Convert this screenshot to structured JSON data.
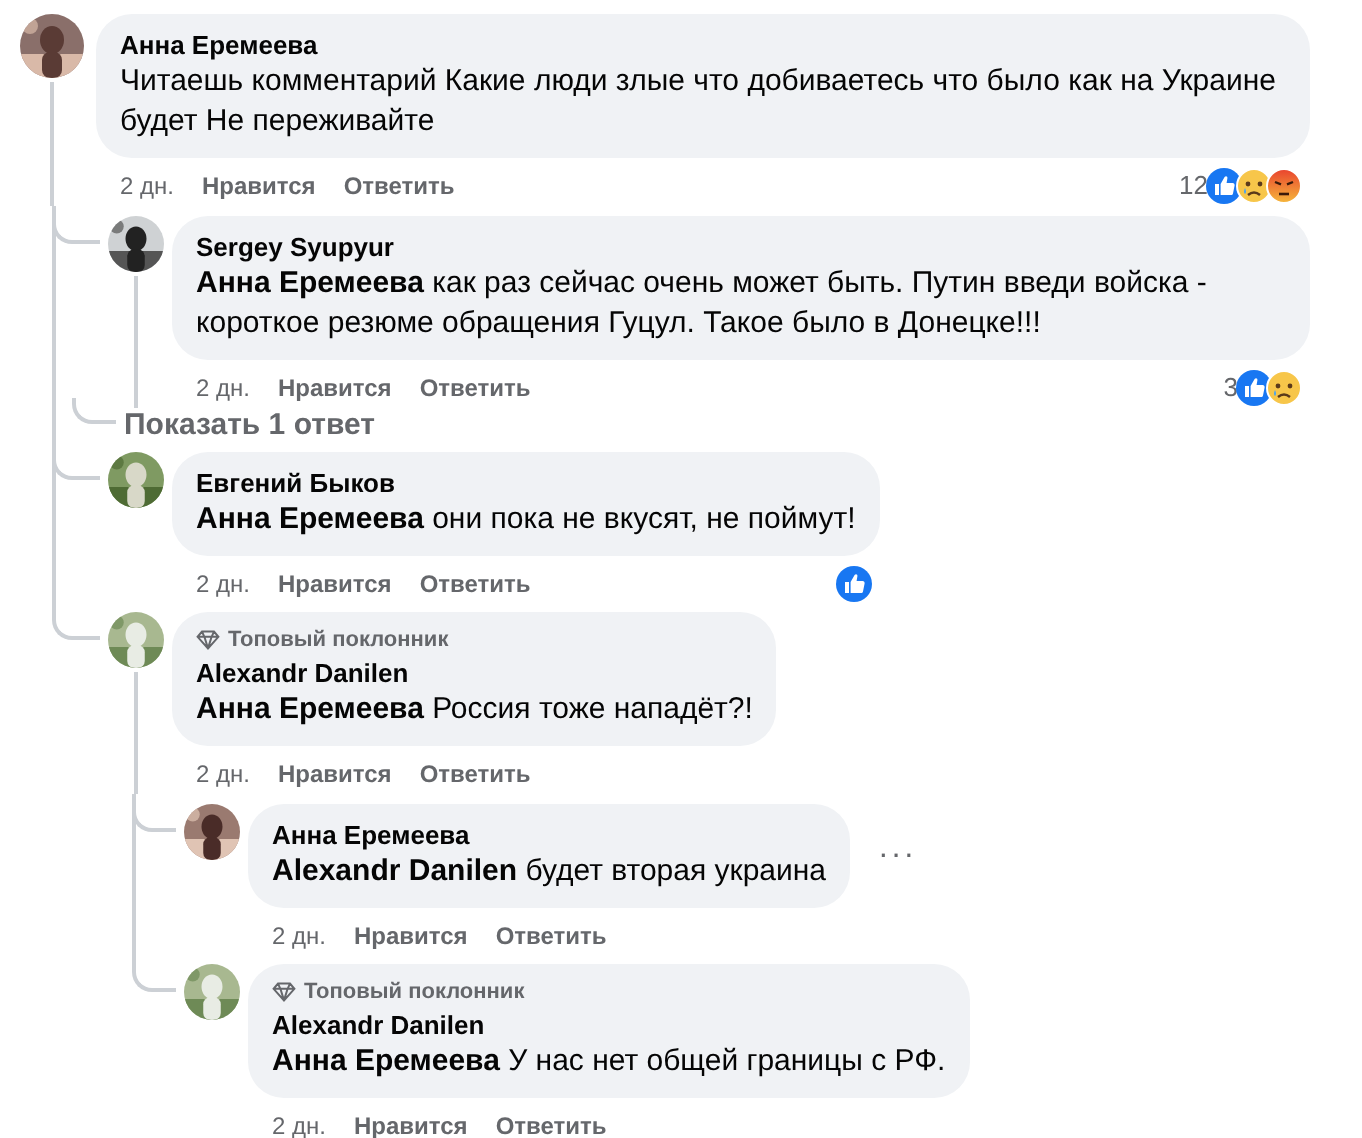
{
  "comments": [
    {
      "author": "Анна Еремеева",
      "text": "Читаешь комментарий Какие люди злые что добиваетесь что было как на Украине будет Не переживайте",
      "time": "2 дн.",
      "like": "Нравится",
      "reply": "Ответить",
      "reactions": {
        "count": "12",
        "icons": [
          {
            "kind": "like"
          },
          {
            "kind": "sad"
          },
          {
            "kind": "angry"
          }
        ]
      },
      "children": [
        {
          "author": "Sergey Syupyur",
          "text": "**Анна Еремеева** как раз сейчас очень может быть. Путин введи войска - короткое резюме обращения Гуцул. Такое было в Донецке!!!",
          "time": "2 дн.",
          "like": "Нравится",
          "reply": "Ответить",
          "reactions": {
            "count": "3",
            "icons": [
              {
                "kind": "like"
              },
              {
                "kind": "sad"
              }
            ]
          },
          "more_replies": "Показать 1 ответ"
        },
        {
          "author": "Евгений Быков",
          "text": "**Анна Еремеева** они пока не вкусят, не поймут!",
          "time": "2 дн.",
          "like": "Нравится",
          "reply": "Ответить",
          "reactions": {
            "icons": [
              {
                "kind": "like"
              }
            ]
          }
        },
        {
          "badge": "Топовый поклонник",
          "author": "Alexandr Danilen",
          "text": "**Анна Еремеева** Россия тоже нападёт?!",
          "time": "2 дн.",
          "like": "Нравится",
          "reply": "Ответить",
          "children": [
            {
              "author": "Анна Еремеева",
              "text": "**Alexandr Danilen** будет вторая украина",
              "time": "2 дн.",
              "like": "Нравится",
              "reply": "Ответить",
              "menu": "···"
            },
            {
              "badge": "Топовый поклонник",
              "author": "Alexandr Danilen",
              "text": "**Анна Еремеева** У нас нет общей границы с РФ.",
              "time": "2 дн.",
              "like": "Нравится",
              "reply": "Ответить"
            }
          ]
        }
      ]
    }
  ]
}
